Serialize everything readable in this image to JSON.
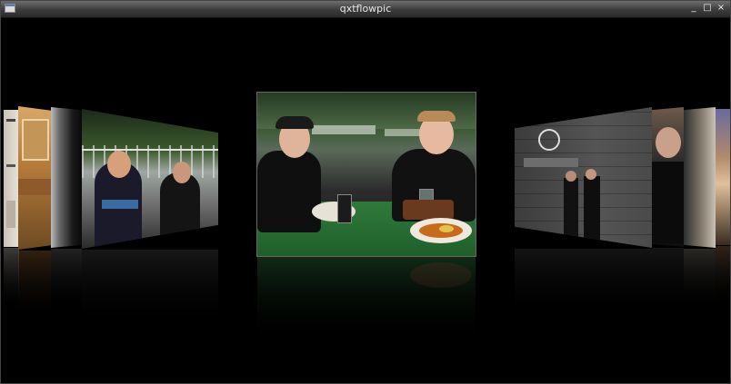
{
  "window": {
    "title": "qxtflowpic",
    "controls": [
      "_",
      "□",
      "×"
    ]
  },
  "flow": {
    "current_index": 4,
    "photos": [
      "far-left-document",
      "left-interior",
      "left-dark-gradient",
      "left-two-men-fence",
      "center-two-men-beer-garden",
      "right-two-men-wall",
      "right-person-closeup",
      "right-grey-card",
      "far-right-photo"
    ]
  }
}
